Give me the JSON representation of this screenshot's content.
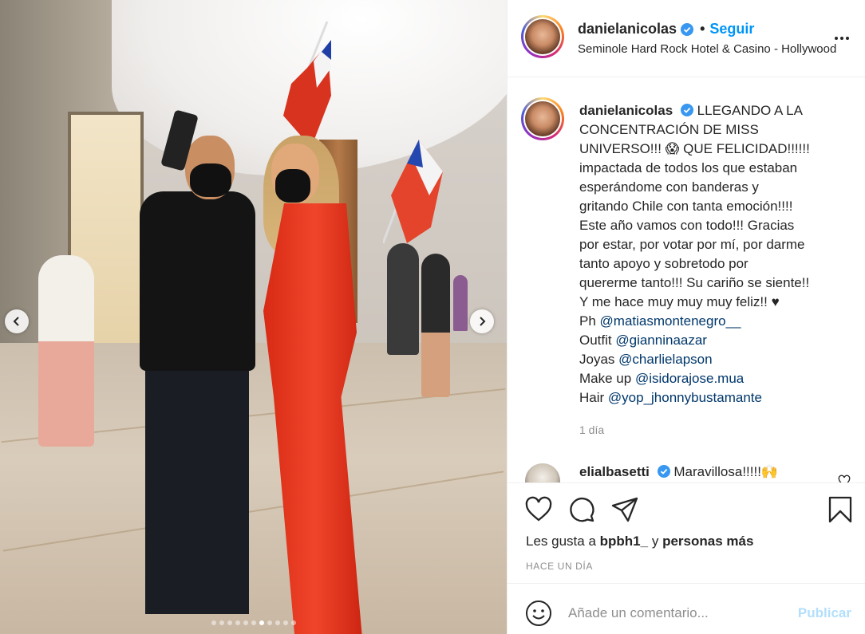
{
  "post": {
    "carousel": {
      "dot_count": 11,
      "active_dot": 6
    },
    "header": {
      "username": "danielanicolas",
      "separator": "•",
      "follow_label": "Seguir",
      "location": "Seminole Hard Rock Hotel & Casino - Hollywood"
    },
    "caption": {
      "username": "danielanicolas",
      "lines": [
        "LLEGANDO A LA",
        "CONCENTRACIÓN DE MISS",
        "UNIVERSO!!! 😱 QUE FELICIDAD!!!!!!",
        "impactada de todos los que estaban",
        "esperándome con banderas y",
        "gritando Chile con tanta emoción!!!!",
        "Este año vamos con todo!!! Gracias",
        "por estar, por votar por mí, por darme",
        "tanto apoyo y sobretodo por",
        "quererme tanto!!! Su cariño se siente!!",
        "Y me hace muy muy muy feliz!! ♥"
      ],
      "credits": [
        {
          "label": "Ph",
          "mention": "@matiasmontenegro__"
        },
        {
          "label": "Outfit",
          "mention": "@gianninaazar"
        },
        {
          "label": "Joyas",
          "mention": "@charlielapson"
        },
        {
          "label": "Make up",
          "mention": "@isidorajose.mua"
        },
        {
          "label": "Hair",
          "mention": "@yop_jhonnybustamante"
        }
      ],
      "time": "1 día"
    },
    "comment": {
      "username": "elialbasetti",
      "text": "Maravillosa!!!!!🙌"
    },
    "likes": {
      "prefix": "Les gusta a",
      "user": "bpbh1_",
      "middle": "y",
      "others": "personas más"
    },
    "posted_ago": "HACE UN DÍA",
    "composer": {
      "placeholder": "Añade un comentario...",
      "publish_label": "Publicar"
    }
  },
  "colors": {
    "accent": "#0095f6",
    "mention": "#00376b",
    "muted": "#8e8e8e",
    "publish_disabled": "#b2dffc"
  }
}
